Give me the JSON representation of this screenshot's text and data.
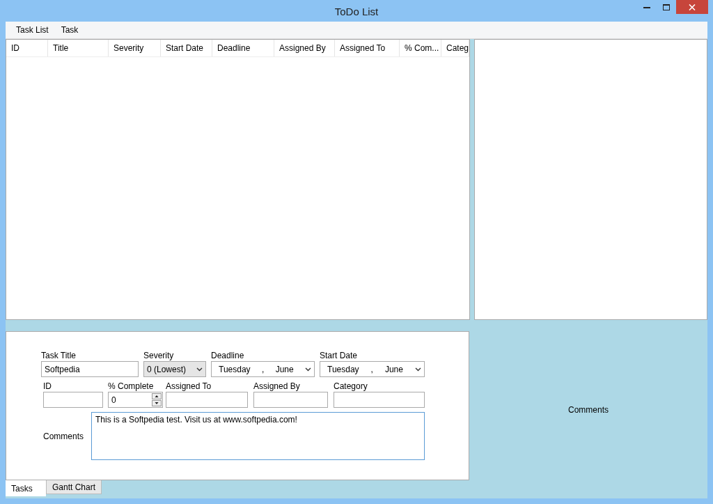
{
  "window": {
    "title": "ToDo List"
  },
  "menu": [
    "Task List",
    "Task"
  ],
  "table": {
    "columns": [
      "ID",
      "Title",
      "Severity",
      "Start Date",
      "Deadline",
      "Assigned By",
      "Assigned To",
      "% Com...",
      "Categ"
    ]
  },
  "side_panel": {
    "caption": "Comments"
  },
  "form": {
    "fields": [
      {
        "kind": "text",
        "label": "Task Title",
        "value": "Softpedia"
      },
      {
        "kind": "select",
        "label": "Severity",
        "value": "0 (Lowest)"
      },
      {
        "kind": "date",
        "label": "Deadline",
        "day": "Tuesday",
        "sep": ",",
        "month": "June"
      },
      {
        "kind": "date",
        "label": "Start Date",
        "day": "Tuesday",
        "sep": ",",
        "month": "June"
      },
      {
        "kind": "text",
        "label": "ID"
      },
      {
        "kind": "spin",
        "label": "% Complete",
        "value": "0"
      },
      {
        "kind": "text",
        "label": "Assigned To"
      },
      {
        "kind": "text",
        "label": "Assigned By"
      },
      {
        "kind": "text",
        "label": "Category"
      }
    ],
    "comments": {
      "label": "Comments",
      "value": "This is a Softpedia test. Visit us at www.softpedia.com!"
    }
  },
  "tabs": [
    {
      "label": "Tasks",
      "selected": true
    },
    {
      "label": "Gantt Chart",
      "selected": false
    }
  ]
}
